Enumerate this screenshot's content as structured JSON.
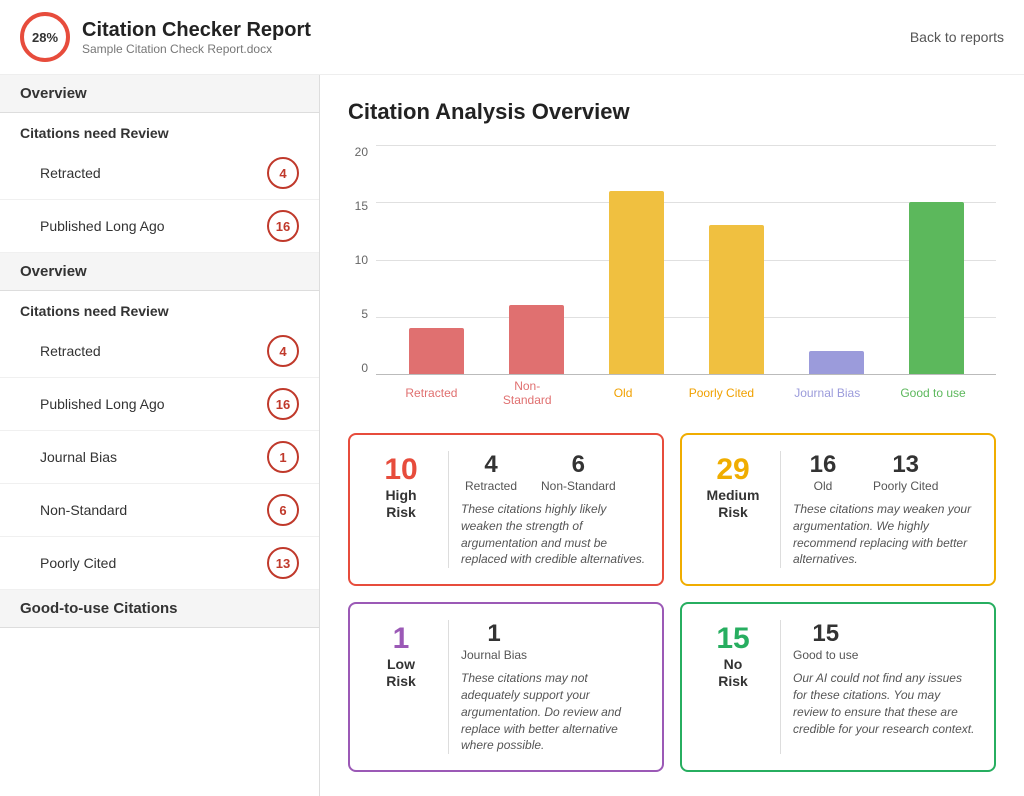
{
  "header": {
    "percentage": "28%",
    "title": "Citation Checker Report",
    "subtitle": "Sample Citation Check Report.docx",
    "back_link": "Back to reports"
  },
  "sidebar": {
    "sections": [
      {
        "id": "overview-1",
        "header": "Overview",
        "sub_header": null,
        "items": []
      },
      {
        "id": "citations-review-1",
        "header": null,
        "sub_header": "Citations need Review",
        "items": [
          {
            "label": "Retracted",
            "count": "4"
          },
          {
            "label": "Published Long Ago",
            "count": "16"
          }
        ]
      },
      {
        "id": "overview-2",
        "header": "Overview",
        "sub_header": null,
        "items": []
      },
      {
        "id": "citations-review-2",
        "header": null,
        "sub_header": "Citations need Review",
        "items": [
          {
            "label": "Retracted",
            "count": "4"
          },
          {
            "label": "Published Long Ago",
            "count": "16"
          },
          {
            "label": "Journal Bias",
            "count": "1"
          },
          {
            "label": "Non-Standard",
            "count": "6"
          },
          {
            "label": "Poorly Cited",
            "count": "13"
          }
        ]
      },
      {
        "id": "good-citations",
        "header": "Good-to-use Citations",
        "sub_header": null,
        "items": []
      }
    ]
  },
  "main": {
    "title": "Citation Analysis Overview",
    "chart": {
      "y_labels": [
        "20",
        "15",
        "10",
        "5",
        "0"
      ],
      "max": 20,
      "bars": [
        {
          "label": "Retracted",
          "value": 4,
          "class": "bar-retracted",
          "label_class": "label-retracted"
        },
        {
          "label": "Non-Standard",
          "value": 6,
          "class": "bar-nonstandard",
          "label_class": "label-nonstandard"
        },
        {
          "label": "Old",
          "value": 16,
          "class": "bar-old",
          "label_class": "label-old"
        },
        {
          "label": "Poorly Cited",
          "value": 13,
          "class": "bar-poorlycited",
          "label_class": "label-poorlycited"
        },
        {
          "label": "Journal Bias",
          "value": 2,
          "class": "bar-journalbias",
          "label_class": "label-journalbias"
        },
        {
          "label": "Good to use",
          "value": 15,
          "class": "bar-goodtouse",
          "label_class": "label-goodtouse"
        }
      ]
    },
    "cards": [
      {
        "type": "high",
        "big_number": "10",
        "risk_label": "High\nRisk",
        "border_color": "#e74c3c",
        "number_color": "high-color",
        "stats": [
          {
            "number": "4",
            "label": "Retracted"
          },
          {
            "number": "6",
            "label": "Non-Standard"
          }
        ],
        "description": "These citations highly likely weaken the strength of argumentation and must be replaced with credible alternatives."
      },
      {
        "type": "medium",
        "big_number": "29",
        "risk_label": "Medium\nRisk",
        "border_color": "#f0ad00",
        "number_color": "medium-color",
        "stats": [
          {
            "number": "16",
            "label": "Old"
          },
          {
            "number": "13",
            "label": "Poorly Cited"
          }
        ],
        "description": "These citations may weaken your argumentation. We highly recommend replacing with better alternatives."
      },
      {
        "type": "low",
        "big_number": "1",
        "risk_label": "Low\nRisk",
        "border_color": "#9b59b6",
        "number_color": "low-color",
        "stats": [
          {
            "number": "1",
            "label": "Journal Bias"
          }
        ],
        "description": "These citations may not adequately support your argumentation. Do review and replace with better alternative where possible."
      },
      {
        "type": "no",
        "big_number": "15",
        "risk_label": "No\nRisk",
        "border_color": "#27ae60",
        "number_color": "no-color",
        "stats": [
          {
            "number": "15",
            "label": "Good to use"
          }
        ],
        "description": "Our AI could not find any issues for these citations. You may review to ensure that these are credible for your research context."
      }
    ]
  }
}
